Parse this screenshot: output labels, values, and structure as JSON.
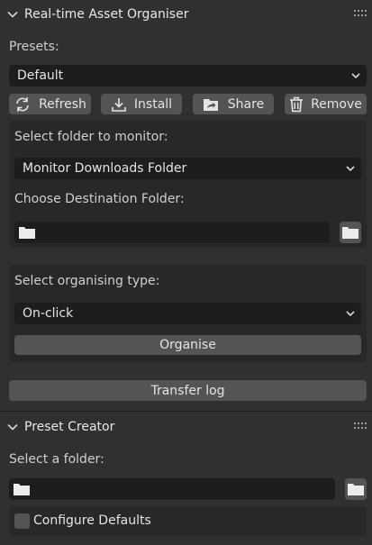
{
  "asset_panel": {
    "title": "Real-time Asset Organiser",
    "presets_label": "Presets:",
    "preset_value": "Default",
    "buttons": {
      "refresh": "Refresh",
      "install": "Install",
      "share": "Share",
      "remove": "Remove"
    },
    "monitor_label": "Select folder to monitor:",
    "monitor_value": "Monitor Downloads Folder",
    "destination_label": "Choose Destination Folder:",
    "destination_value": "",
    "organising_type_label": "Select organising type:",
    "organising_type_value": "On-click",
    "organise_button": "Organise",
    "transfer_log_button": "Transfer log"
  },
  "preset_creator": {
    "title": "Preset Creator",
    "folder_label": "Select a folder:",
    "folder_value": "",
    "configure_defaults_label": "Configure Defaults",
    "configure_defaults_checked": false
  },
  "icons": {
    "collapse": "chevron-down-icon",
    "drag": "drag-grip-icon",
    "refresh": "refresh-icon",
    "install": "download-icon",
    "share": "share-icon",
    "remove": "trash-icon",
    "folder": "folder-icon"
  },
  "colors": {
    "background": "#303030",
    "panel": "#282828",
    "field": "#1d1d1d",
    "button": "#545454",
    "text": "#e4e4e4"
  }
}
